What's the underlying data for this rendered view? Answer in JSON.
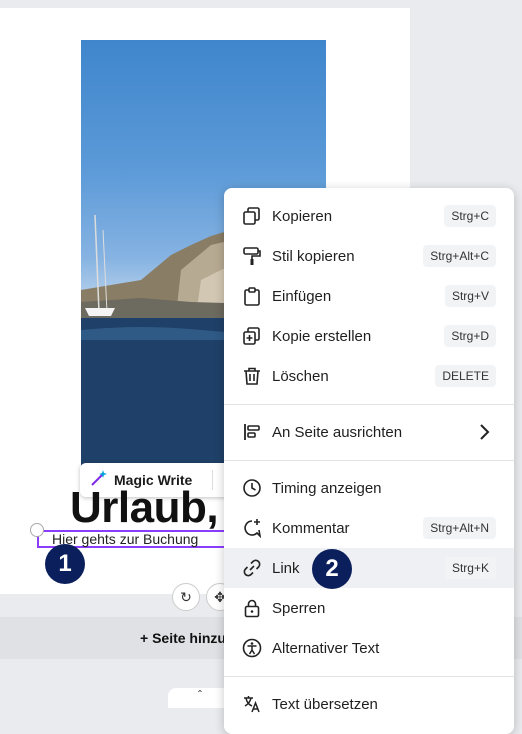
{
  "canvas": {
    "heading": "Urlaub,",
    "subtitle": "Hier gehts zur Buchung",
    "magic_write_label": "Magic Write",
    "add_page_label": "+ Seite hinzu",
    "bottom_tab_glyph": "ˆ"
  },
  "badges": {
    "step1": "1",
    "step2": "2"
  },
  "context_menu": {
    "items": [
      {
        "label": "Kopieren",
        "shortcut": "Strg+C",
        "icon": "copy-icon"
      },
      {
        "label": "Stil kopieren",
        "shortcut": "Strg+Alt+C",
        "icon": "paint-roller-icon"
      },
      {
        "label": "Einfügen",
        "shortcut": "Strg+V",
        "icon": "clipboard-icon"
      },
      {
        "label": "Kopie erstellen",
        "shortcut": "Strg+D",
        "icon": "duplicate-icon"
      },
      {
        "label": "Löschen",
        "shortcut": "DELETE",
        "icon": "trash-icon"
      },
      {
        "label": "An Seite ausrichten",
        "shortcut": "",
        "icon": "align-icon"
      },
      {
        "label": "Timing anzeigen",
        "shortcut": "",
        "icon": "clock-icon"
      },
      {
        "label": "Kommentar",
        "shortcut": "Strg+Alt+N",
        "icon": "comment-icon"
      },
      {
        "label": "Link",
        "shortcut": "Strg+K",
        "icon": "link-icon"
      },
      {
        "label": "Sperren",
        "shortcut": "",
        "icon": "lock-icon"
      },
      {
        "label": "Alternativer Text",
        "shortcut": "",
        "icon": "accessibility-icon"
      },
      {
        "label": "Text übersetzen",
        "shortcut": "",
        "icon": "translate-icon"
      }
    ],
    "active_item": "Link"
  },
  "colors": {
    "selection": "#8b3dff",
    "badge": "#0b1f5c",
    "menu_hover": "#eef0f3"
  }
}
